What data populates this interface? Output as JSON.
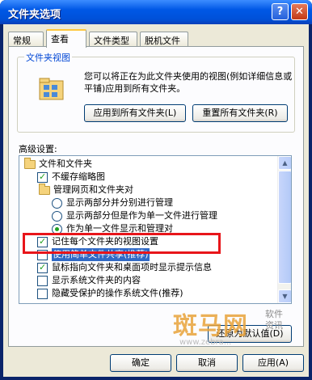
{
  "window": {
    "title": "文件夹选项",
    "help_label": "?",
    "close_label": "✕"
  },
  "tabs": [
    {
      "label": "常规"
    },
    {
      "label": "查看"
    },
    {
      "label": "文件类型"
    },
    {
      "label": "脱机文件"
    }
  ],
  "folder_views": {
    "title": "文件夹视图",
    "description": "您可以将正在为此文件夹使用的视图(例如详细信息或平铺)应用到所有文件夹。",
    "apply_all_label": "应用到所有文件夹(L)",
    "reset_all_label": "重置所有文件夹(R)"
  },
  "advanced": {
    "label": "高级设置:",
    "items": [
      {
        "kind": "folder",
        "label": "文件和文件夹"
      },
      {
        "kind": "checkbox",
        "checked": true,
        "label": "不缓存缩略图"
      },
      {
        "kind": "folder",
        "label": "管理网页和文件夹对"
      },
      {
        "kind": "radio",
        "checked": false,
        "label": "显示两部分并分别进行管理"
      },
      {
        "kind": "radio",
        "checked": false,
        "label": "显示两部分但是作为单一文件进行管理"
      },
      {
        "kind": "radio",
        "checked": true,
        "label": "作为单一文件显示和管理对"
      },
      {
        "kind": "checkbox",
        "checked": true,
        "label": "记住每个文件夹的视图设置"
      },
      {
        "kind": "checkbox",
        "checked": false,
        "label": "使用简单文件共享(推荐)"
      },
      {
        "kind": "checkbox",
        "checked": true,
        "label": "鼠标指向文件夹和桌面项时显示提示信息"
      },
      {
        "kind": "checkbox",
        "checked": false,
        "label": "显示系统文件夹的内容"
      },
      {
        "kind": "checkbox",
        "checked": false,
        "label": "隐藏受保护的操作系统文件(推荐)"
      }
    ],
    "restore_defaults_label": "还原为默认值(D)"
  },
  "footer": {
    "ok_label": "确定",
    "cancel_label": "取消",
    "apply_label": "应用(A)"
  },
  "watermark": {
    "main": "斑马网",
    "side_top": "软件",
    "side_bottom": "资讯",
    "url": "www.zebra..."
  },
  "colors": {
    "titlebar": "#0058e6",
    "face": "#ece9d8",
    "highlight": "#316ac5",
    "annotation": "#e8151a",
    "group_title": "#0046d5"
  }
}
